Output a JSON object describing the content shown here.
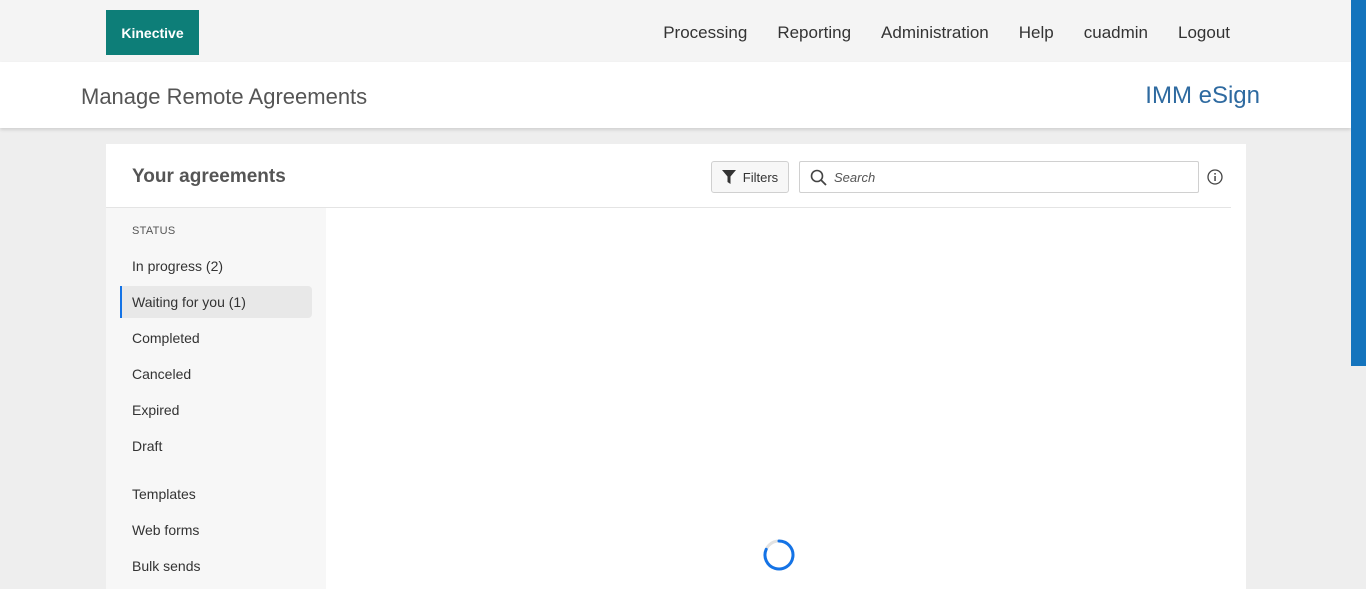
{
  "header": {
    "logo": "Kinective",
    "nav": [
      "Processing",
      "Reporting",
      "Administration",
      "Help",
      "cuadmin",
      "Logout"
    ]
  },
  "subheader": {
    "title": "Manage Remote Agreements",
    "brand": "IMM eSign"
  },
  "agreements": {
    "title": "Your agreements",
    "filters_label": "Filters",
    "search_placeholder": "Search"
  },
  "sidebar": {
    "section_label": "STATUS",
    "status_items": [
      "In progress (2)",
      "Waiting for you (1)",
      "Completed",
      "Canceled",
      "Expired",
      "Draft"
    ],
    "other_items": [
      "Templates",
      "Web forms",
      "Bulk sends"
    ],
    "active_item": "Waiting for you (1)"
  },
  "colors": {
    "logo_bg": "#0d7e78",
    "brand": "#2e6aa0",
    "accent": "#1473e6",
    "scrollbar": "#1474bd"
  },
  "icons": [
    "filter-icon",
    "search-icon",
    "info-icon",
    "loading-spinner-icon"
  ]
}
